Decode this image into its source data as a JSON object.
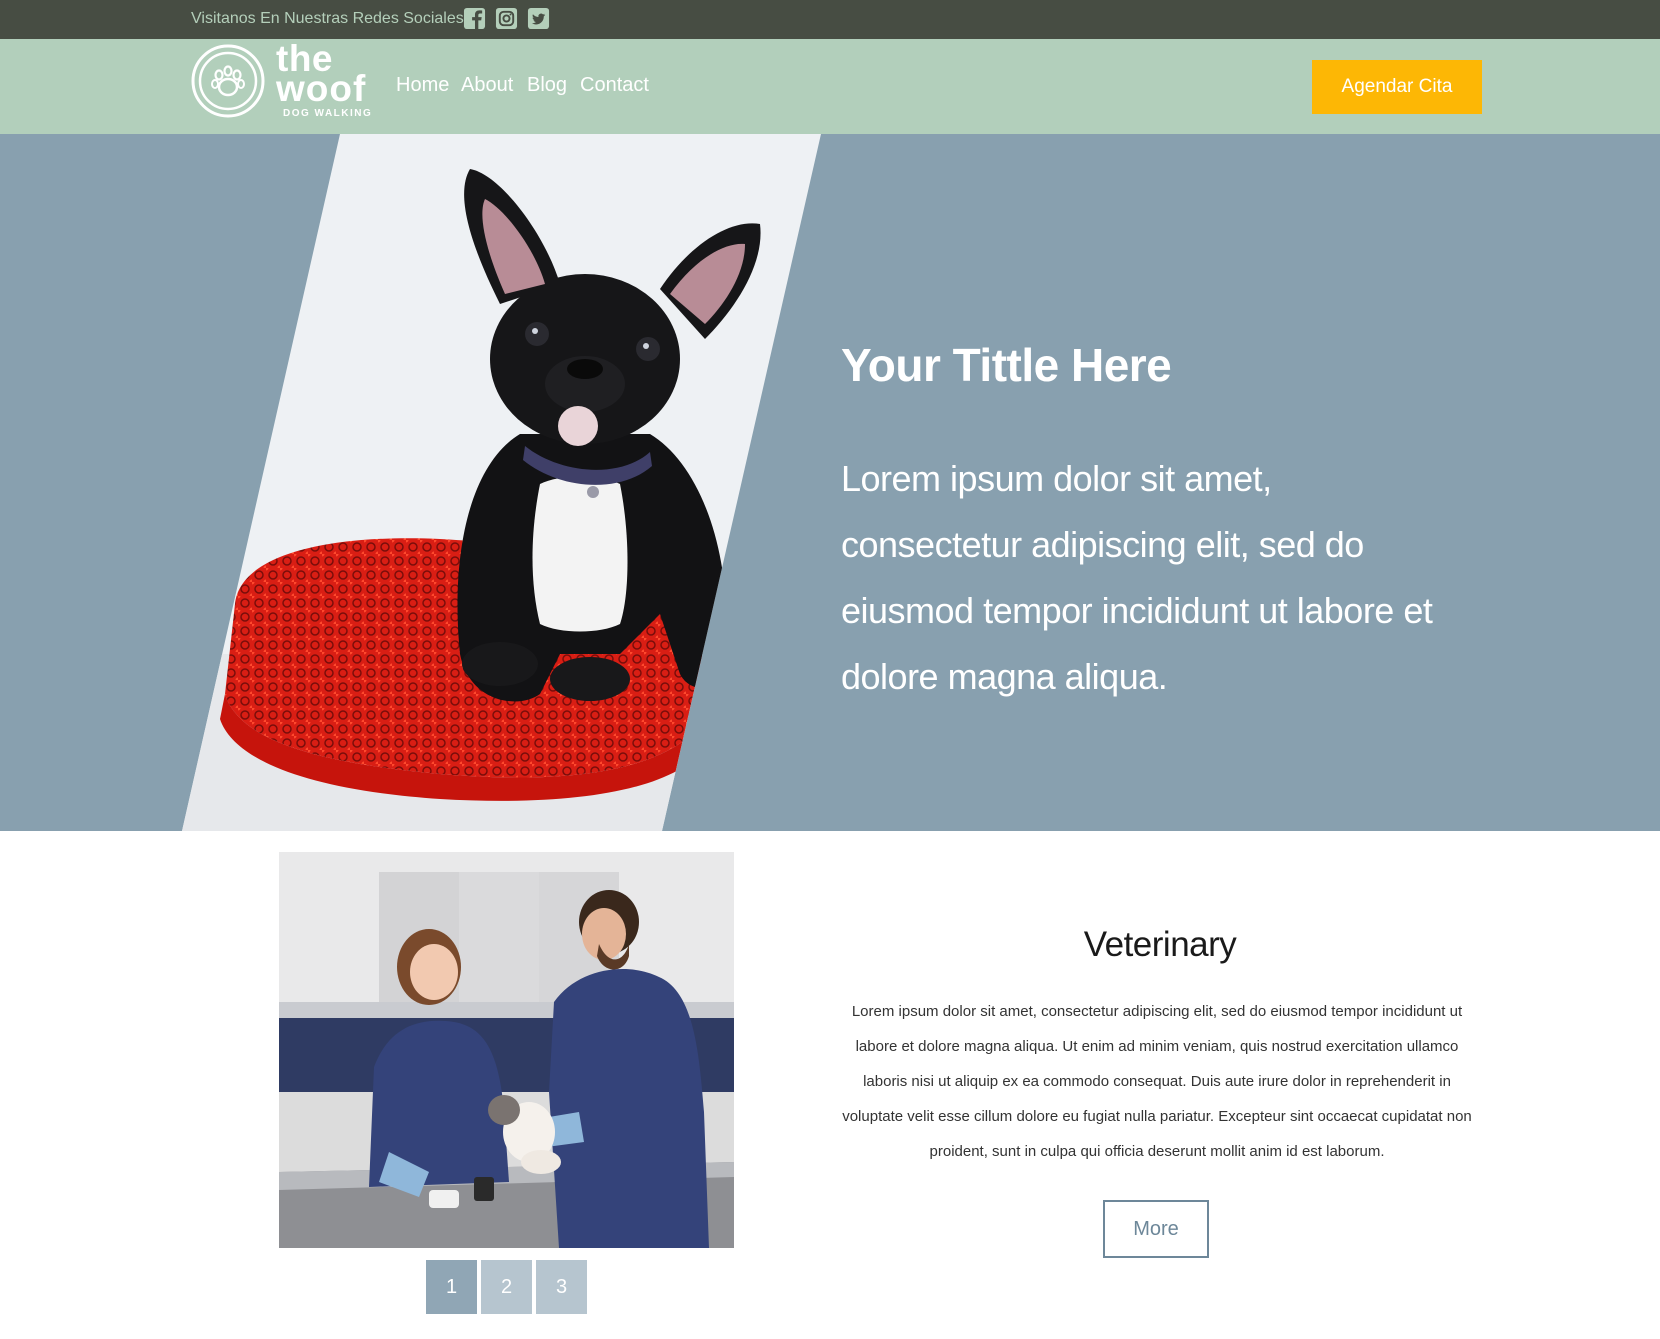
{
  "topbar": {
    "social_text": "Visitanos En Nuestras Redes Sociales",
    "icons": [
      "facebook-icon",
      "instagram-icon",
      "twitter-icon"
    ],
    "icon_color": "#b4cfba",
    "background": "#474d43"
  },
  "navbar": {
    "logo": {
      "line1": "the",
      "line2": "woof",
      "tagline": "DOG WALKING",
      "icon": "paw-icon"
    },
    "links": [
      "Home",
      "About",
      "Blog",
      "Contact"
    ],
    "cta_label": "Agendar Cita",
    "background": "#b2cfbb",
    "cta_color": "#fdb705"
  },
  "hero": {
    "title": "Your Tittle Here",
    "text": "Lorem ipsum dolor sit amet, consectetur adipiscing elit, sed do eiusmod tempor incididunt ut labore et dolore magna aliqua.",
    "image": "french-bulldog-on-red-cushion",
    "background": "#88a0af"
  },
  "service": {
    "title": "Veterinary",
    "text": "Lorem ipsum dolor sit amet, consectetur adipiscing elit, sed do eiusmod tempor incididunt ut labore et dolore magna aliqua. Ut enim ad minim veniam, quis nostrud exercitation ullamco laboris nisi ut aliquip ex ea commodo consequat. Duis aute irure dolor in reprehenderit in voluptate velit esse cillum dolore eu fugiat nulla pariatur. Excepteur sint occaecat cupidatat non proident, sunt in culpa qui officia deserunt mollit anim id est laborum.",
    "more_label": "More",
    "image": "veterinarians-with-cat",
    "pager": {
      "pages": [
        "1",
        "2",
        "3"
      ],
      "active": "1",
      "active_color": "#90a6b5",
      "inactive_color": "#b6c5cf"
    }
  }
}
